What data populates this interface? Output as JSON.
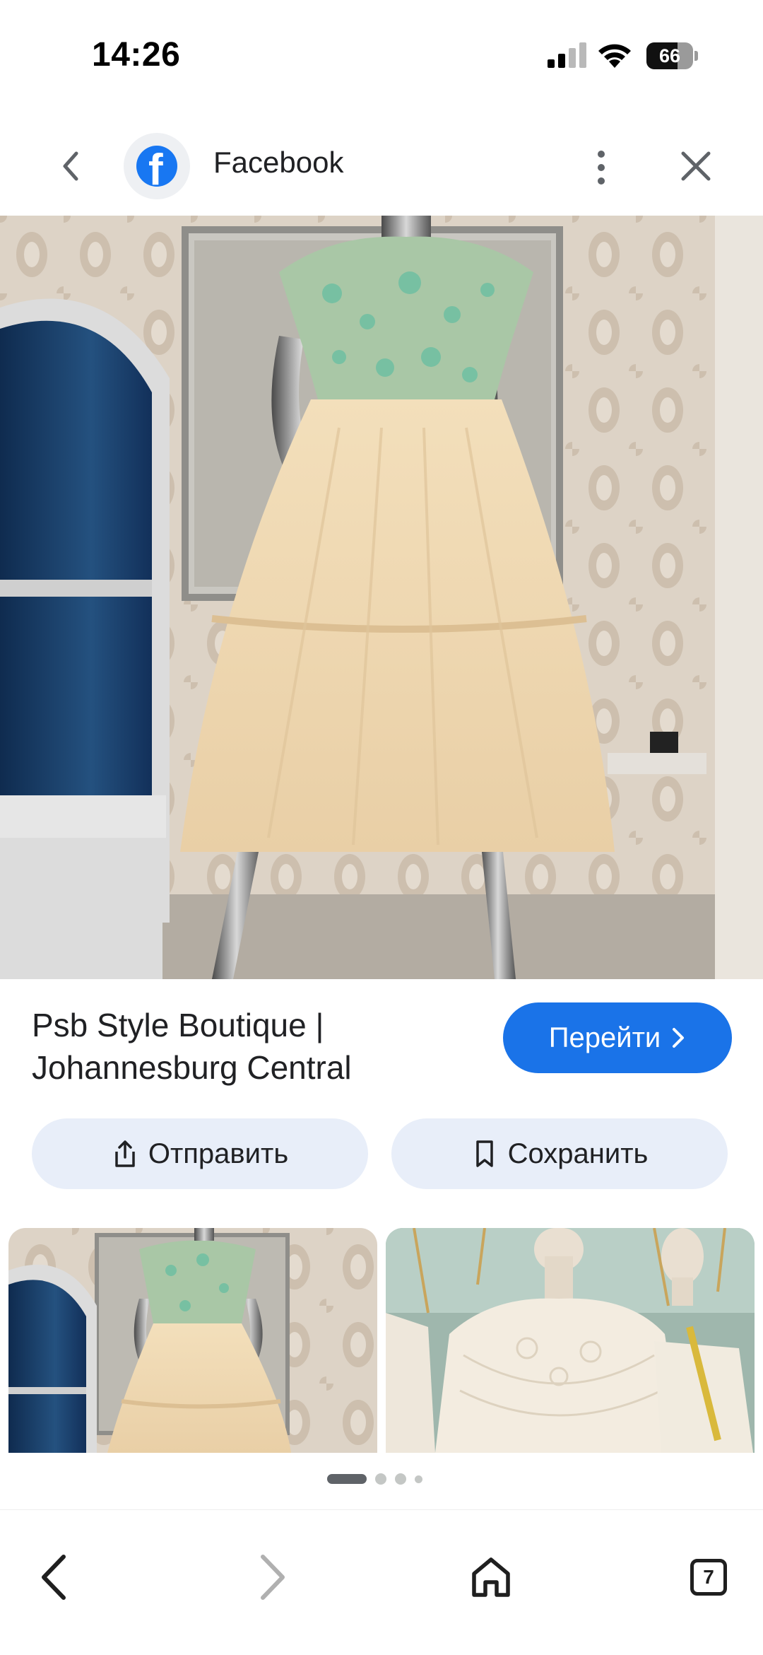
{
  "status_bar": {
    "time": "14:26",
    "battery_level": "66",
    "battery_fraction": 0.66,
    "signal_icon": "cellular-signal-icon",
    "wifi_icon": "wifi-icon"
  },
  "header": {
    "back_icon": "chevron-left-icon",
    "site_icon": "facebook-logo-icon",
    "site_name": "Facebook",
    "more_icon": "more-vertical-icon",
    "close_icon": "close-icon"
  },
  "result": {
    "title": "Psb Style Boutique | Johannesburg Central",
    "visit_label": "Перейти",
    "visit_icon": "chevron-right-icon",
    "share_label": "Отправить",
    "share_icon": "share-icon",
    "save_label": "Сохранить",
    "save_icon": "bookmark-icon"
  },
  "pager": {
    "total": 4,
    "active": 1
  },
  "bottom_nav": {
    "back_icon": "arrow-back-icon",
    "forward_icon": "arrow-forward-icon",
    "home_icon": "home-icon",
    "tab_count": "7"
  },
  "colors": {
    "accent": "#1a73e8",
    "chip_bg": "#e8eef9",
    "facebook_blue": "#1877f2"
  }
}
